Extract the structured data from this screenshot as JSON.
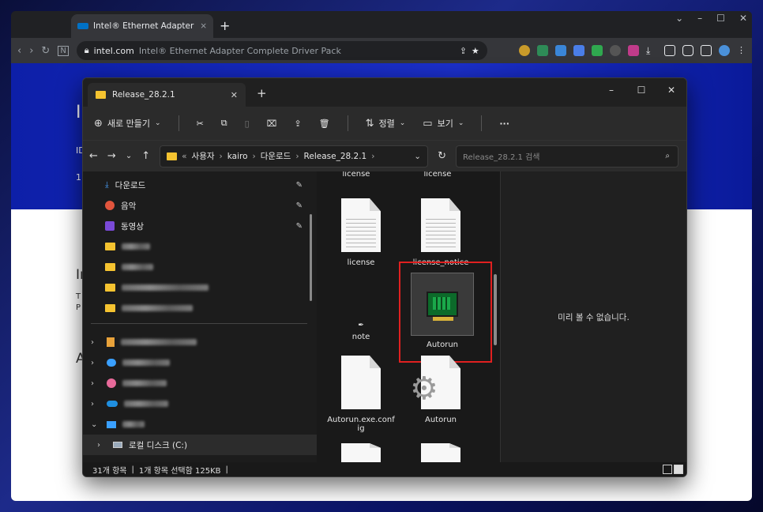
{
  "browser": {
    "tab_title": "Intel® Ethernet Adapter Comple",
    "new_tab": "+",
    "url_domain": "intel.com",
    "url_rest": "Intel® Ethernet Adapter Complete Driver Pack"
  },
  "page": {
    "frag1": "I",
    "frag2": "ID",
    "frag3": "1",
    "frag4": "In",
    "frag5": "T",
    "frag6": "P",
    "frag7": "A"
  },
  "explorer": {
    "tab_title": "Release_28.2.1",
    "tab_close": "✕",
    "new_tab": "+",
    "commands": {
      "new": "새로 만들기",
      "sort": "정렬",
      "view": "보기",
      "more": "···"
    },
    "breadcrumb": [
      "사용자",
      "kairo",
      "다운로드",
      "Release_28.2.1"
    ],
    "search_placeholder": "Release_28.2.1 검색",
    "quick_access": [
      {
        "label": "다운로드",
        "icon": "download-icon"
      },
      {
        "label": "음악",
        "icon": "music-icon"
      },
      {
        "label": "동영상",
        "icon": "video-icon"
      }
    ],
    "local_disk": "로컬 디스크 (C:)",
    "files": {
      "license1": "license",
      "license2": "license",
      "license3": "license",
      "license_notice": "license_notice",
      "note": "note",
      "autorun_selected": "Autorun",
      "autorun_config": "Autorun.exe.conf ig",
      "autorun_other": "Autorun"
    },
    "preview_text": "미리 볼 수 없습니다.",
    "status": {
      "count": "31개 항목",
      "selected": "1개 항목 선택함 125KB"
    }
  },
  "colors": {
    "highlight": "#e02020",
    "folder": "#f5c330"
  }
}
